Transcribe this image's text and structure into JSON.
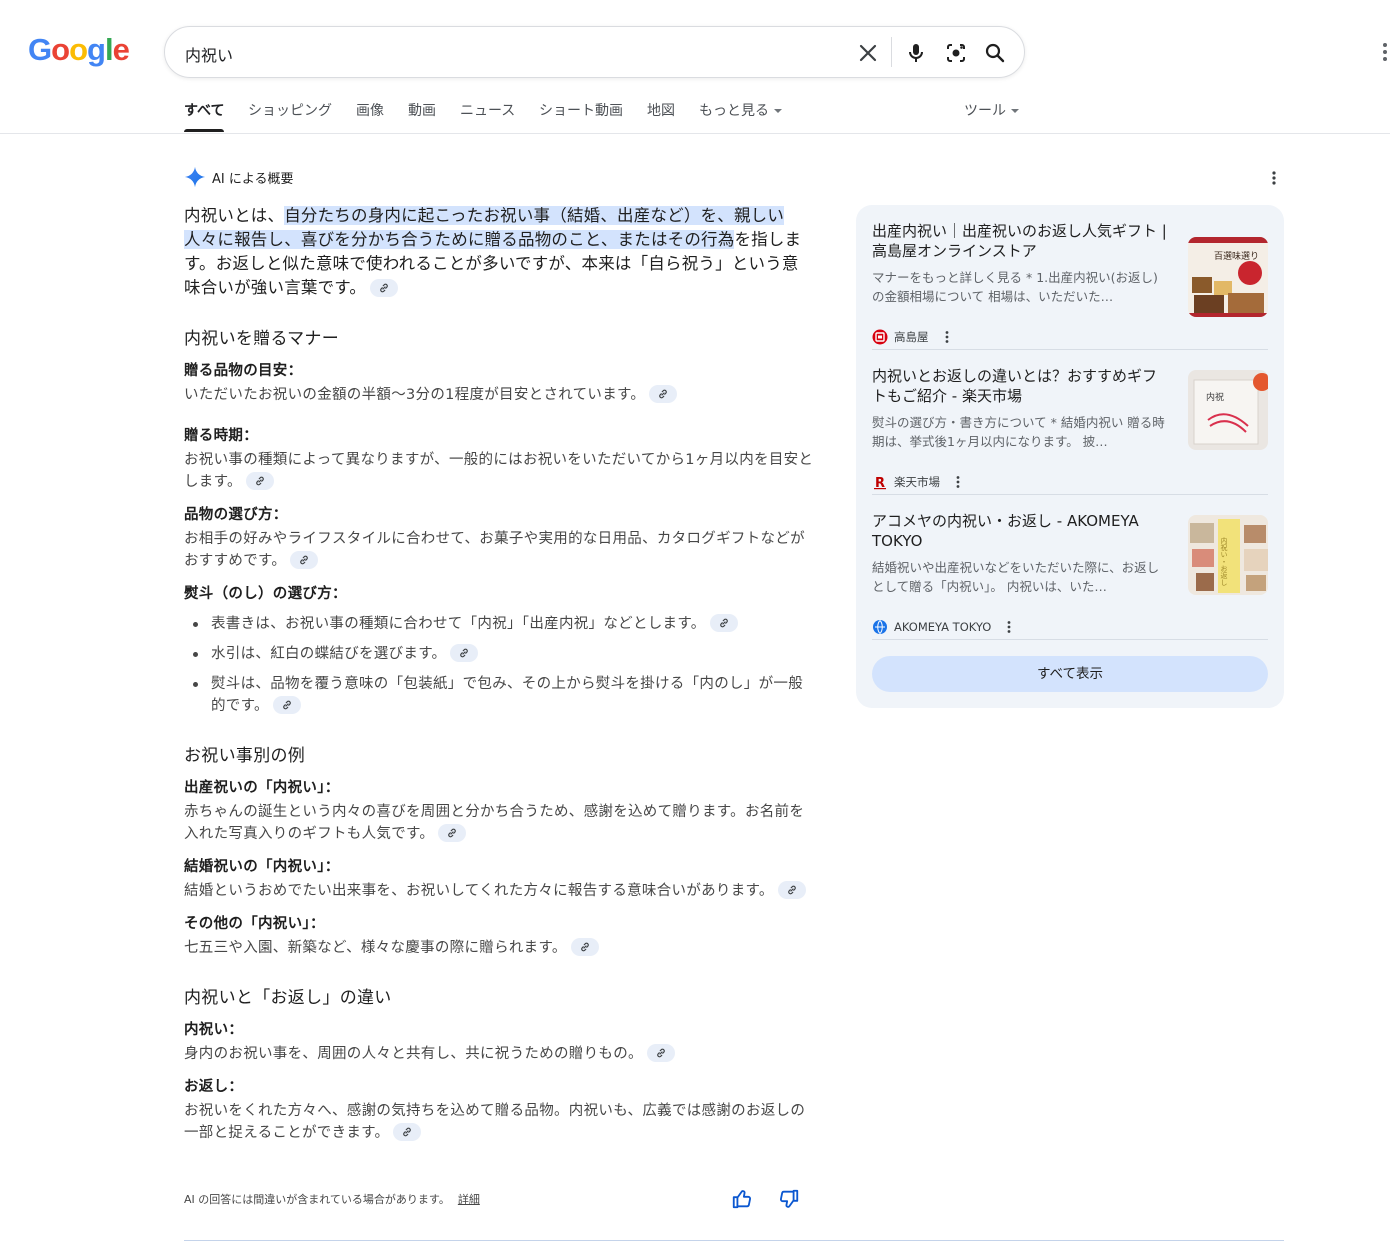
{
  "logo": {
    "letters": [
      "G",
      "o",
      "o",
      "g",
      "l",
      "e"
    ],
    "colors": [
      "#4285F4",
      "#EA4335",
      "#FBBC05",
      "#4285F4",
      "#34A853",
      "#EA4335"
    ]
  },
  "search": {
    "query": "内祝い"
  },
  "tabs": [
    {
      "label": "すべて",
      "active": true
    },
    {
      "label": "ショッピング"
    },
    {
      "label": "画像"
    },
    {
      "label": "動画"
    },
    {
      "label": "ニュース"
    },
    {
      "label": "ショート動画"
    },
    {
      "label": "地図"
    },
    {
      "label": "もっと見る"
    },
    {
      "label": "ツール"
    }
  ],
  "ai": {
    "heading": "AI による概要",
    "lead": {
      "pre": "内祝いとは、",
      "highlight": "自分たちの身内に起こったお祝い事（結婚、出産など）を、親しい人々に報告し、喜びを分かち合うために贈る品物のこと、またはその行為",
      "post": "を指します。お返しと似た意味で使われることが多いですが、本来は「自ら祝う」という意味合いが強い言葉です。"
    },
    "sections": [
      {
        "title": "内祝いを贈るマナー",
        "items": [
          {
            "label": "贈る品物の目安：",
            "text": "いただいたお祝いの金額の半額〜3分の1程度が目安とされています。"
          },
          {
            "label": "贈る時期：",
            "text": "お祝い事の種類によって異なりますが、一般的にはお祝いをいただいてから1ヶ月以内を目安とします。"
          },
          {
            "label": "品物の選び方：",
            "text": "お相手の好みやライフスタイルに合わせて、お菓子や実用的な日用品、カタログギフトなどがおすすめです。"
          },
          {
            "label": "熨斗（のし）の選び方：",
            "bullets": [
              "表書きは、お祝い事の種類に合わせて「内祝」「出産内祝」などとします。",
              "水引は、紅白の蝶結びを選びます。",
              "熨斗は、品物を覆う意味の「包装紙」で包み、その上から熨斗を掛ける「内のし」が一般的です。"
            ]
          }
        ]
      },
      {
        "title": "お祝い事別の例",
        "items": [
          {
            "label": "出産祝いの「内祝い」：",
            "text": "赤ちゃんの誕生という内々の喜びを周囲と分かち合うため、感謝を込めて贈ります。お名前を入れた写真入りのギフトも人気です。"
          },
          {
            "label": "結婚祝いの「内祝い」：",
            "text": "結婚というおめでたい出来事を、お祝いしてくれた方々に報告する意味合いがあります。"
          },
          {
            "label": "その他の「内祝い」：",
            "text": "七五三や入園、新築など、様々な慶事の際に贈られます。"
          }
        ]
      },
      {
        "title": "内祝いと「お返し」の違い",
        "items": [
          {
            "label": "内祝い：",
            "text": "身内のお祝い事を、周囲の人々と共有し、共に祝うための贈りもの。"
          },
          {
            "label": "お返し：",
            "text": "お祝いをくれた方々へ、感謝の気持ちを込めて贈る品物。内祝いも、広義では感謝のお返しの一部と捉えることができます。"
          }
        ]
      }
    ],
    "disclaimer": "AI の回答には間違いが含まれている場合があります。",
    "details_link": "詳細"
  },
  "sources": [
    {
      "title": "出産内祝い｜出産祝いのお返し人気ギフト | 高島屋オンラインストア",
      "snippet": "マナーをもっと詳しく見る * 1.出産内祝い(お返し)の金額相場について 相場は、いただいた…",
      "source": "高島屋",
      "thumb_text": "百選味選り"
    },
    {
      "title": "内祝いとお返しの違いとは？おすすめギフトもご紹介 - 楽天市場",
      "snippet": "熨斗の選び方・書き方について * 結婚内祝い 贈る時期は、挙式後1ヶ月以内になります。 披…",
      "source": "楽天市場",
      "thumb_text": "内祝"
    },
    {
      "title": "アコメヤの内祝い・お返し - AKOMEYA TOKYO",
      "snippet": "結婚祝いや出産祝いなどをいただいた際に、お返しとして贈る「内祝い」。 内祝いは、いた…",
      "source": "AKOMEYA TOKYO",
      "thumb_text": "内祝い・お返し"
    }
  ],
  "show_all": "すべて表示"
}
